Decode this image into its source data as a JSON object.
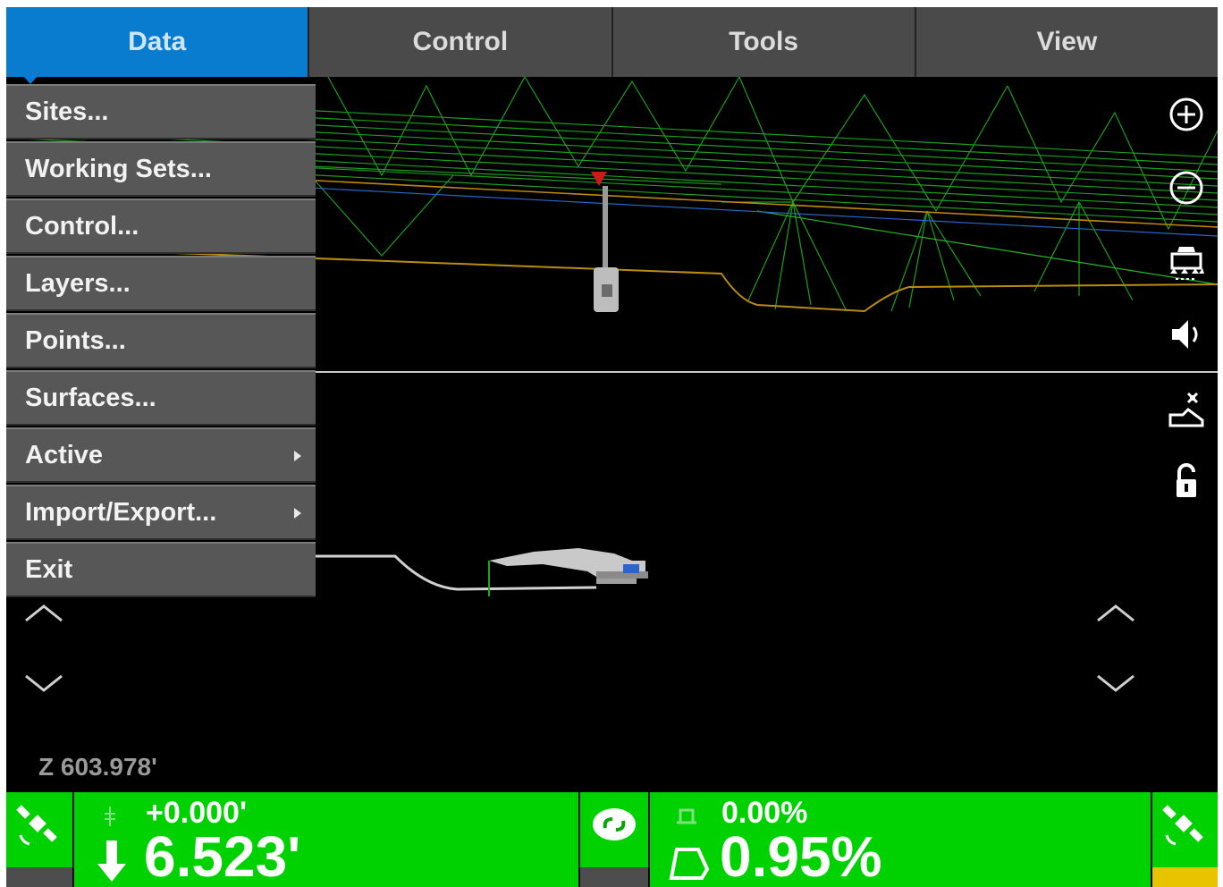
{
  "menubar": {
    "tabs": [
      {
        "label": "Data",
        "active": true
      },
      {
        "label": "Control",
        "active": false
      },
      {
        "label": "Tools",
        "active": false
      },
      {
        "label": "View",
        "active": false
      }
    ]
  },
  "dropdown": {
    "items": [
      {
        "label": "Sites...",
        "submenu": false
      },
      {
        "label": "Working Sets...",
        "submenu": false
      },
      {
        "label": "Control...",
        "submenu": false
      },
      {
        "label": "Layers...",
        "submenu": false
      },
      {
        "label": "Points...",
        "submenu": false
      },
      {
        "label": "Surfaces...",
        "submenu": false
      },
      {
        "label": "Active",
        "submenu": true
      },
      {
        "label": "Import/Export...",
        "submenu": true
      },
      {
        "label": "Exit",
        "submenu": false
      }
    ]
  },
  "view": {
    "elevation": "Z 603.978'"
  },
  "status": {
    "cut_offset": "+0.000'",
    "cut_fill": "6.523'",
    "cross_slope": "0.00%",
    "main_slope": "0.95%"
  },
  "colors": {
    "accent": "#0a7ccf",
    "status_green": "#00d100",
    "surface_green": "#1fa81f",
    "menu_gray": "#575757"
  },
  "icons": [
    "zoom-in-icon",
    "zoom-out-icon",
    "machine-view-icon",
    "speaker-icon",
    "bucket-icon",
    "lock-icon",
    "satellite-icon",
    "link-icon"
  ]
}
